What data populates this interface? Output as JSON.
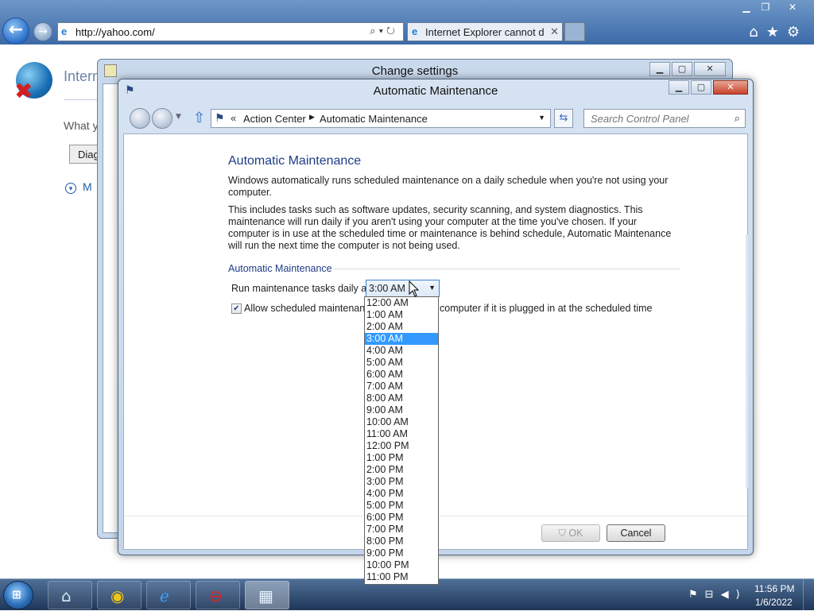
{
  "ie": {
    "address": "http://yahoo.com/",
    "tab_title": "Internet Explorer cannot dis...",
    "error_title": "Intern",
    "what_text": "What y",
    "diag_button": "Diag",
    "more_text": "M"
  },
  "change_settings": {
    "title": "Change settings"
  },
  "window": {
    "title": "Automatic Maintenance"
  },
  "breadcrumb": {
    "prefix": "«",
    "items": [
      "Action Center",
      "Automatic Maintenance"
    ]
  },
  "search": {
    "placeholder": "Search Control Panel"
  },
  "content": {
    "heading": "Automatic Maintenance",
    "para1": "Windows automatically runs scheduled maintenance on a daily schedule when you're not using your computer.",
    "para2": "This includes tasks such as software updates, security scanning, and system diagnostics. This maintenance will run daily if you aren't using your computer at the time you've chosen. If your computer is in use at the scheduled time or maintenance is behind schedule, Automatic Maintenance will run the next time the computer is not being used.",
    "group_label": "Automatic Maintenance",
    "run_label": "Run maintenance tasks daily at",
    "selected_time": "3:00 AM",
    "checkbox_label_left": "Allow scheduled maintenanc",
    "checkbox_label_right": "computer if it is plugged in at the scheduled time",
    "checkbox_checked": true
  },
  "dropdown": {
    "options": [
      "12:00 AM",
      "1:00 AM",
      "2:00 AM",
      "3:00 AM",
      "4:00 AM",
      "5:00 AM",
      "6:00 AM",
      "7:00 AM",
      "8:00 AM",
      "9:00 AM",
      "10:00 AM",
      "11:00 AM",
      "12:00 PM",
      "1:00 PM",
      "2:00 PM",
      "3:00 PM",
      "4:00 PM",
      "5:00 PM",
      "6:00 PM",
      "7:00 PM",
      "8:00 PM",
      "9:00 PM",
      "10:00 PM",
      "11:00 PM"
    ],
    "selected_index": 3
  },
  "buttons": {
    "ok": "OK",
    "cancel": "Cancel"
  },
  "taskbar": {
    "time": "11:56 PM",
    "date": "1/6/2022"
  },
  "colors": {
    "accent": "#3399ff",
    "heading": "#1e3c87"
  }
}
